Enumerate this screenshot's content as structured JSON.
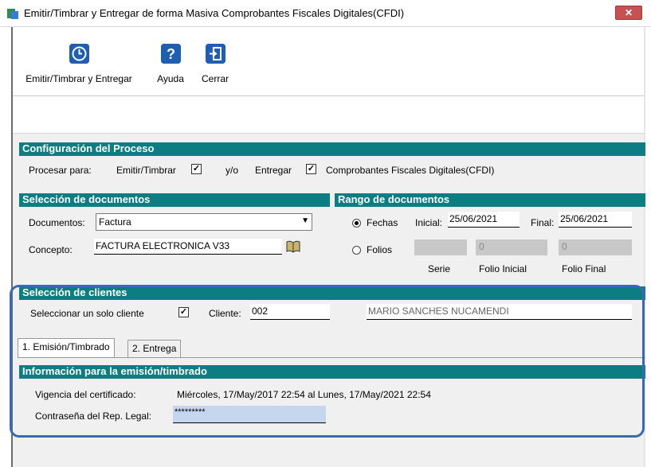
{
  "window": {
    "title": "Emitir/Timbrar y Entregar de forma Masiva Comprobantes Fiscales Digitales(CFDI)",
    "close_label": "✕"
  },
  "toolbar": {
    "items": [
      {
        "label": "Emitir/Timbrar y Entregar",
        "icon": "clock-icon"
      },
      {
        "label": "Ayuda",
        "icon": "help-icon"
      },
      {
        "label": "Cerrar",
        "icon": "exit-door-icon"
      }
    ]
  },
  "config": {
    "heading": "Configuración del Proceso",
    "procesar_label": "Procesar para:",
    "emitir_label": "Emitir/Timbrar",
    "emitir_checked": true,
    "yo_label": "y/o",
    "entregar_label": "Entregar",
    "entregar_checked": true,
    "cfdi_label": "Comprobantes Fiscales Digitales(CFDI)"
  },
  "documentos": {
    "heading": "Selección de documentos",
    "documentos_label": "Documentos:",
    "documentos_value": "Factura",
    "concepto_label": "Concepto:",
    "concepto_value": "FACTURA ELECTRONICA V33"
  },
  "rango": {
    "heading": "Rango de documentos",
    "fechas_label": "Fechas",
    "fechas_selected": true,
    "inicial_label": "Inicial:",
    "inicial_value": "25/06/2021",
    "final_label": "Final:",
    "final_value": "25/06/2021",
    "folios_label": "Folios",
    "folios_selected": false,
    "folio_inicial_value": "0",
    "folio_final_value": "0",
    "serie_label": "Serie",
    "folio_inicial_label": "Folio Inicial",
    "folio_final_label": "Folio Final"
  },
  "clientes": {
    "heading": "Selección de clientes",
    "solo_cliente_label": "Seleccionar un solo cliente",
    "solo_cliente_checked": true,
    "cliente_label": "Cliente:",
    "cliente_value": "002",
    "cliente_nombre": "MARIO SANCHES NUCAMENDI"
  },
  "tabs": [
    {
      "label": "1. Emisión/Timbrado",
      "active": true
    },
    {
      "label": "2. Entrega",
      "active": false
    }
  ],
  "emision": {
    "heading": "Información para la emisión/timbrado",
    "vigencia_label": "Vigencia del certificado:",
    "vigencia_value": "Miércoles, 17/May/2017 22:54 al Lunes, 17/May/2021 22:54",
    "contrasena_label": "Contraseña del Rep. Legal:",
    "contrasena_value": "*********"
  },
  "colors": {
    "section_header": "#0c7e82",
    "highlight": "#3a67b8",
    "toolbar_icon": "#1f5fb2"
  }
}
